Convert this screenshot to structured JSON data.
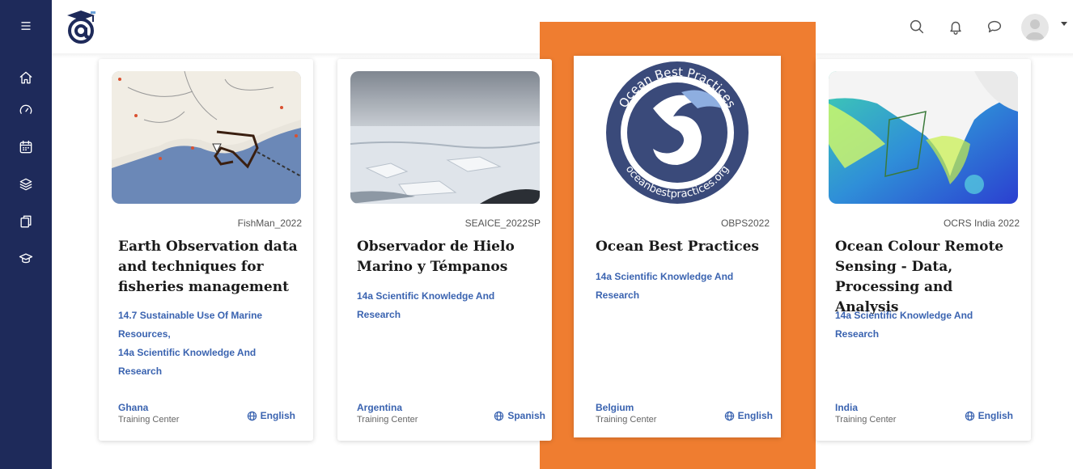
{
  "nav": {
    "items": [
      {
        "name": "menu",
        "icon": "menu-icon"
      },
      {
        "name": "home",
        "icon": "home-icon"
      },
      {
        "name": "dashboard",
        "icon": "gauge-icon"
      },
      {
        "name": "calendar",
        "icon": "calendar-icon"
      },
      {
        "name": "layers",
        "icon": "layers-icon"
      },
      {
        "name": "documents",
        "icon": "documents-icon"
      },
      {
        "name": "courses",
        "icon": "graduation-cap-icon"
      }
    ]
  },
  "header": {
    "icons": [
      "search-icon",
      "bell-icon",
      "chat-icon",
      "avatar",
      "chevron-down-icon"
    ]
  },
  "colors": {
    "sidebar": "#1e2a5a",
    "highlight": "#ef7d30",
    "link": "#3a63b0"
  },
  "courses": [
    {
      "code": "FishMan_2022",
      "title": "Earth Observation data and techniques for fisheries management",
      "tags": [
        "14.7 Sustainable Use Of Marine",
        "Resources,",
        "14a Scientific Knowledge And",
        "Research"
      ],
      "country": "Ghana",
      "center": "Training Center",
      "language": "English"
    },
    {
      "code": "SEAICE_2022SP",
      "title": "Observador de Hielo Marino y Témpanos",
      "tags": [
        "14a Scientific Knowledge And",
        "Research"
      ],
      "country": "Argentina",
      "center": "Training Center",
      "language": "Spanish"
    },
    {
      "code": "OBPS2022",
      "title": "Ocean Best Practices",
      "tags": [
        "14a Scientific Knowledge And",
        "Research"
      ],
      "country": "Belgium",
      "center": "Training Center",
      "language": "English",
      "logo_text_top": "Ocean Best Practices",
      "logo_text_bottom": "oceanbestpractices.org"
    },
    {
      "code": "OCRS India 2022",
      "title": "Ocean Colour Remote Sensing - Data, Processing and Analysis",
      "tags": [
        "14a Scientific Knowledge And",
        "Research"
      ],
      "country": "India",
      "center": "Training Center",
      "language": "English"
    }
  ]
}
